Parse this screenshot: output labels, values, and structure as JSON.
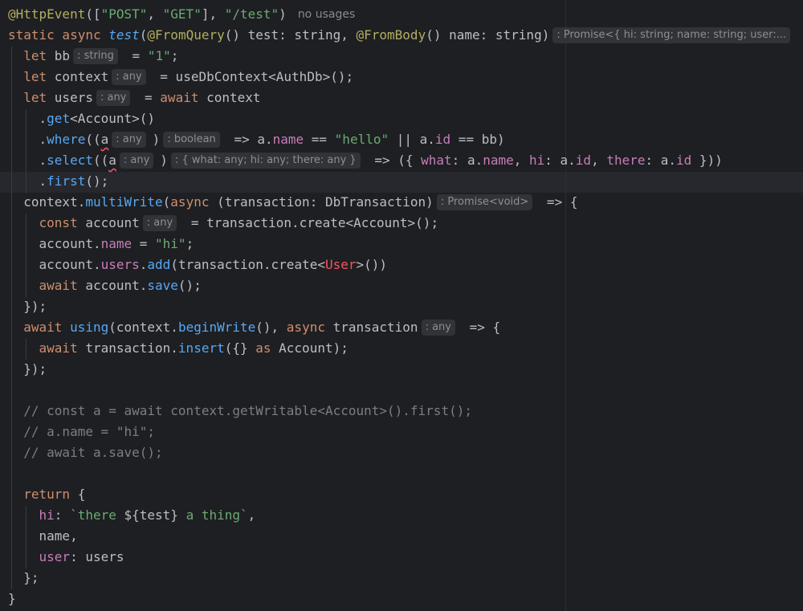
{
  "editor": {
    "theme_colors": {
      "background": "#1e1f22",
      "keyword": "#cf8e6d",
      "string": "#6aab73",
      "annotation": "#b3ae60",
      "function": "#56a8f5",
      "property": "#c77dbb",
      "comment": "#7a7e85",
      "error": "#f75464",
      "inlay_hint_bg": "#313337"
    },
    "lines": [
      [
        {
          "t": "@HttpEvent",
          "c": "ann"
        },
        {
          "t": "([",
          "c": "pl"
        },
        {
          "t": "\"POST\"",
          "c": "str"
        },
        {
          "t": ", ",
          "c": "pl"
        },
        {
          "t": "\"GET\"",
          "c": "str"
        },
        {
          "t": "], ",
          "c": "pl"
        },
        {
          "t": "\"/test\"",
          "c": "str"
        },
        {
          "t": ")",
          "c": "pl"
        },
        {
          "t": "no usages",
          "c": "usages"
        }
      ],
      [
        {
          "t": "static async ",
          "c": "kw"
        },
        {
          "t": "test",
          "c": "fni"
        },
        {
          "t": "(",
          "c": "pl"
        },
        {
          "t": "@FromQuery",
          "c": "ann"
        },
        {
          "t": "() test: string, ",
          "c": "pl"
        },
        {
          "t": "@FromBody",
          "c": "ann"
        },
        {
          "t": "() name: string)",
          "c": "pl"
        },
        {
          "t": ": Promise<{ hi: string; name: string; user:...",
          "c": "hint"
        },
        {
          "t": " {",
          "c": "pl"
        }
      ],
      [
        {
          "t": "  "
        },
        {
          "t": "let ",
          "c": "kw"
        },
        {
          "t": "bb",
          "c": "pl"
        },
        {
          "t": ": string",
          "c": "hint"
        },
        {
          "t": " = ",
          "c": "pl"
        },
        {
          "t": "\"1\"",
          "c": "str"
        },
        {
          "t": ";",
          "c": "pl"
        }
      ],
      [
        {
          "t": "  "
        },
        {
          "t": "let ",
          "c": "kw"
        },
        {
          "t": "context",
          "c": "pl"
        },
        {
          "t": ": any",
          "c": "hint"
        },
        {
          "t": " = useDbContext<AuthDb>();",
          "c": "pl"
        }
      ],
      [
        {
          "t": "  "
        },
        {
          "t": "let ",
          "c": "kw"
        },
        {
          "t": "users",
          "c": "pl"
        },
        {
          "t": ": any",
          "c": "hint"
        },
        {
          "t": " = ",
          "c": "pl"
        },
        {
          "t": "await ",
          "c": "kw"
        },
        {
          "t": "context",
          "c": "pl"
        }
      ],
      [
        {
          "t": "    ."
        },
        {
          "t": "get",
          "c": "fn"
        },
        {
          "t": "<Account>()",
          "c": "pl"
        }
      ],
      [
        {
          "t": "    ."
        },
        {
          "t": "where",
          "c": "fn"
        },
        {
          "t": "((",
          "c": "pl"
        },
        {
          "t": "a",
          "c": "squig"
        },
        {
          "t": ": any",
          "c": "hint"
        },
        {
          "t": ")",
          "c": "pl"
        },
        {
          "t": ": boolean",
          "c": "hint"
        },
        {
          "t": " => a.",
          "c": "pl"
        },
        {
          "t": "name",
          "c": "prop"
        },
        {
          "t": " == ",
          "c": "pl"
        },
        {
          "t": "\"hello\"",
          "c": "str"
        },
        {
          "t": " || a.",
          "c": "pl"
        },
        {
          "t": "id",
          "c": "prop"
        },
        {
          "t": " == bb)",
          "c": "pl"
        }
      ],
      [
        {
          "t": "    ."
        },
        {
          "t": "select",
          "c": "fn"
        },
        {
          "t": "((",
          "c": "pl"
        },
        {
          "t": "a",
          "c": "squig"
        },
        {
          "t": ": any",
          "c": "hint"
        },
        {
          "t": ")",
          "c": "pl"
        },
        {
          "t": ": { what: any; hi: any; there: any }",
          "c": "hint"
        },
        {
          "t": " => ({ ",
          "c": "pl"
        },
        {
          "t": "what",
          "c": "prop"
        },
        {
          "t": ": a.",
          "c": "pl"
        },
        {
          "t": "name",
          "c": "prop"
        },
        {
          "t": ", ",
          "c": "pl"
        },
        {
          "t": "hi",
          "c": "prop"
        },
        {
          "t": ": a.",
          "c": "pl"
        },
        {
          "t": "id",
          "c": "prop"
        },
        {
          "t": ", ",
          "c": "pl"
        },
        {
          "t": "there",
          "c": "prop"
        },
        {
          "t": ": a.",
          "c": "pl"
        },
        {
          "t": "id",
          "c": "prop"
        },
        {
          "t": " }))",
          "c": "pl"
        }
      ],
      [
        {
          "t": "    ."
        },
        {
          "t": "first",
          "c": "fn"
        },
        {
          "t": "();",
          "c": "pl"
        }
      ],
      [
        {
          "t": "  context."
        },
        {
          "t": "multiWrite",
          "c": "fn"
        },
        {
          "t": "(",
          "c": "pl"
        },
        {
          "t": "async ",
          "c": "kw"
        },
        {
          "t": "(transaction: DbTransaction)",
          "c": "pl"
        },
        {
          "t": ": Promise<void>",
          "c": "hint"
        },
        {
          "t": " => {",
          "c": "pl"
        }
      ],
      [
        {
          "t": "    "
        },
        {
          "t": "const ",
          "c": "kw"
        },
        {
          "t": "account",
          "c": "pl"
        },
        {
          "t": ": any",
          "c": "hint"
        },
        {
          "t": " = transaction.create<Account>();",
          "c": "pl"
        }
      ],
      [
        {
          "t": "    account."
        },
        {
          "t": "name",
          "c": "prop"
        },
        {
          "t": " = ",
          "c": "pl"
        },
        {
          "t": "\"hi\"",
          "c": "str"
        },
        {
          "t": ";",
          "c": "pl"
        }
      ],
      [
        {
          "t": "    account."
        },
        {
          "t": "users",
          "c": "prop"
        },
        {
          "t": ".",
          "c": "pl"
        },
        {
          "t": "add",
          "c": "fn"
        },
        {
          "t": "(transaction.create<",
          "c": "pl"
        },
        {
          "t": "User",
          "c": "err"
        },
        {
          "t": ">())",
          "c": "pl"
        }
      ],
      [
        {
          "t": "    "
        },
        {
          "t": "await ",
          "c": "kw"
        },
        {
          "t": "account.",
          "c": "pl"
        },
        {
          "t": "save",
          "c": "fn"
        },
        {
          "t": "();",
          "c": "pl"
        }
      ],
      [
        {
          "t": "  });"
        }
      ],
      [
        {
          "t": "  "
        },
        {
          "t": "await ",
          "c": "kw"
        },
        {
          "t": "using",
          "c": "fn"
        },
        {
          "t": "(context.",
          "c": "pl"
        },
        {
          "t": "beginWrite",
          "c": "fn"
        },
        {
          "t": "(), ",
          "c": "pl"
        },
        {
          "t": "async ",
          "c": "kw"
        },
        {
          "t": "transaction",
          "c": "pl"
        },
        {
          "t": ": any",
          "c": "hint"
        },
        {
          "t": " => {",
          "c": "pl"
        }
      ],
      [
        {
          "t": "    "
        },
        {
          "t": "await ",
          "c": "kw"
        },
        {
          "t": "transaction.",
          "c": "pl"
        },
        {
          "t": "insert",
          "c": "fn"
        },
        {
          "t": "({} ",
          "c": "pl"
        },
        {
          "t": "as ",
          "c": "kw"
        },
        {
          "t": "Account);",
          "c": "pl"
        }
      ],
      [
        {
          "t": "  });"
        }
      ],
      [],
      [
        {
          "t": "  // const a = await context.getWritable<Account>().first();",
          "c": "cmt"
        }
      ],
      [
        {
          "t": "  // a.name = \"hi\";",
          "c": "cmt"
        }
      ],
      [
        {
          "t": "  // await a.save();",
          "c": "cmt"
        }
      ],
      [],
      [
        {
          "t": "  "
        },
        {
          "t": "return ",
          "c": "kw"
        },
        {
          "t": "{",
          "c": "pl"
        }
      ],
      [
        {
          "t": "    "
        },
        {
          "t": "hi",
          "c": "prop"
        },
        {
          "t": ": ",
          "c": "pl"
        },
        {
          "t": "`there ",
          "c": "str"
        },
        {
          "t": "${test}",
          "c": "pl"
        },
        {
          "t": " a thing`",
          "c": "str"
        },
        {
          "t": ",",
          "c": "pl"
        }
      ],
      [
        {
          "t": "    name,"
        }
      ],
      [
        {
          "t": "    "
        },
        {
          "t": "user",
          "c": "prop"
        },
        {
          "t": ": users",
          "c": "pl"
        }
      ],
      [
        {
          "t": "  };"
        }
      ],
      [
        {
          "t": "}"
        }
      ]
    ]
  }
}
